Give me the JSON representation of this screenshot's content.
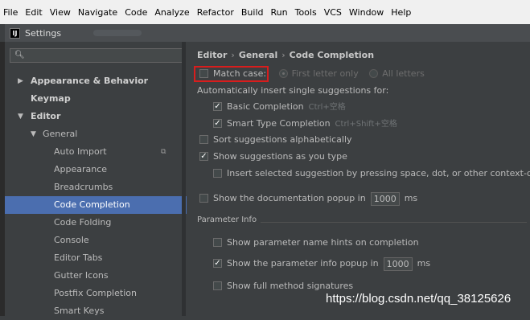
{
  "menubar": [
    "File",
    "Edit",
    "View",
    "Navigate",
    "Code",
    "Analyze",
    "Refactor",
    "Build",
    "Run",
    "Tools",
    "VCS",
    "Window",
    "Help"
  ],
  "window": {
    "title": "Settings",
    "icon_letter": "IJ"
  },
  "search": {
    "icon": "search-icon",
    "placeholder": "",
    "value": ""
  },
  "sidebar": {
    "items": [
      {
        "label": "Appearance & Behavior"
      },
      {
        "label": "Keymap"
      },
      {
        "label": "Editor"
      },
      {
        "label": "General"
      },
      {
        "label": "Auto Import"
      },
      {
        "label": "Appearance"
      },
      {
        "label": "Breadcrumbs"
      },
      {
        "label": "Code Completion"
      },
      {
        "label": "Code Folding"
      },
      {
        "label": "Console"
      },
      {
        "label": "Editor Tabs"
      },
      {
        "label": "Gutter Icons"
      },
      {
        "label": "Postfix Completion"
      },
      {
        "label": "Smart Keys"
      }
    ],
    "selected": "Code Completion"
  },
  "breadcrumb": [
    "Editor",
    "General",
    "Code Completion"
  ],
  "options": {
    "match_case": {
      "label": "Match case:",
      "checked": false
    },
    "first_letter": {
      "label": "First letter only"
    },
    "all_letters": {
      "label": "All letters"
    },
    "auto_insert_label": "Automatically insert single suggestions for:",
    "basic": {
      "label": "Basic Completion",
      "shortcut": "Ctrl+空格",
      "checked": true
    },
    "smart": {
      "label": "Smart Type Completion",
      "shortcut": "Ctrl+Shift+空格",
      "checked": true
    },
    "sort": {
      "label": "Sort suggestions alphabetically",
      "checked": false
    },
    "show_as_type": {
      "label": "Show suggestions as you type",
      "checked": true
    },
    "insert_selected": {
      "label": "Insert selected suggestion by pressing space, dot, or other context-depe",
      "checked": false
    },
    "doc_popup": {
      "label": "Show the documentation popup in",
      "value": "1000",
      "unit": "ms",
      "checked": false
    }
  },
  "param_info": {
    "title": "Parameter Info",
    "hints": {
      "label": "Show parameter name hints on completion",
      "checked": false
    },
    "popup": {
      "label": "Show the parameter info popup in",
      "value": "1000",
      "unit": "ms",
      "checked": true
    },
    "full": {
      "label": "Show full method signatures",
      "checked": false
    }
  },
  "watermark": "https://blog.csdn.net/qq_38125626"
}
